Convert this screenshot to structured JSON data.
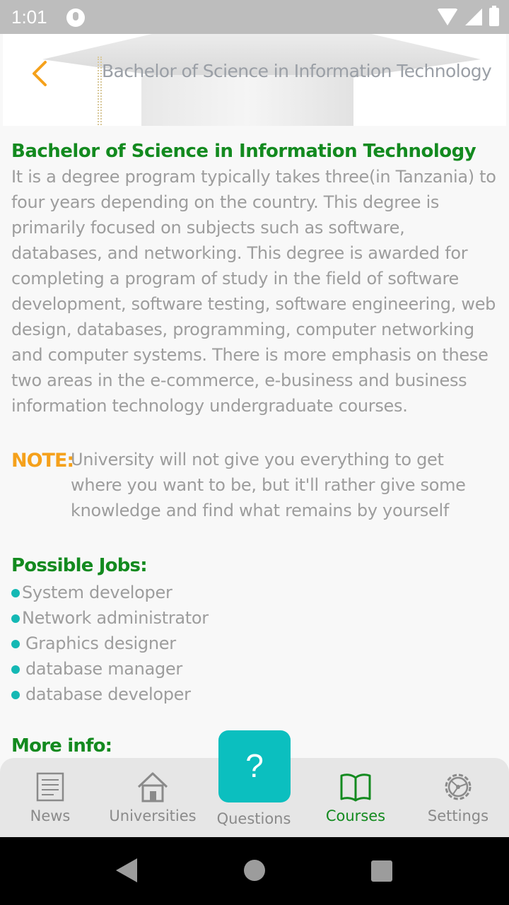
{
  "status_bar": {
    "time": "1:01"
  },
  "header": {
    "title": "Bachelor of Science in Information Technology"
  },
  "content": {
    "title": "Bachelor of Science in Information Technology",
    "description": "It is a degree program typically takes three(in Tanzania) to four years depending on the country. This degree is primarily focused on subjects such as software, databases, and networking. This degree is awarded for completing a program of study in the field of software development, software testing, software engineering, web design, databases, programming, computer networking and computer systems. There is more emphasis on these two areas in the e-commerce, e-business and business information technology undergraduate courses.",
    "note_label": "NOTE:",
    "note_text": "University will not give you everything to get where you want to be, but it'll rather give some knowledge and find what remains by yourself",
    "jobs_heading": "Possible Jobs:",
    "jobs": [
      "System developer",
      "Network administrator",
      "Graphics designer",
      "database manager",
      "database developer"
    ],
    "more_info_heading": "More info:"
  },
  "bottom_nav": {
    "items": [
      {
        "label": "News",
        "icon": "newspaper-icon"
      },
      {
        "label": "Universities",
        "icon": "house-icon"
      },
      {
        "label": "Questions",
        "icon": "question-mark-icon"
      },
      {
        "label": "Courses",
        "icon": "open-book-icon",
        "active": true
      },
      {
        "label": "Settings",
        "icon": "gear-icon"
      }
    ],
    "fab_symbol": "?"
  },
  "colors": {
    "accent_green": "#138a1f",
    "note_orange": "#f5a11b",
    "teal": "#0bbfbf",
    "body_text": "#9d9d9d"
  }
}
